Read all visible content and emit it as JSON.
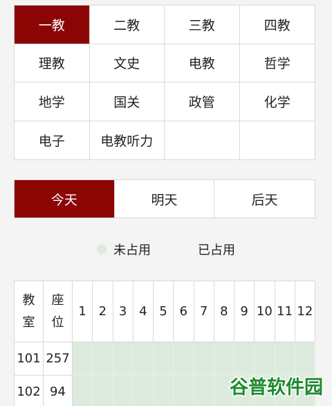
{
  "buildings": [
    "一教",
    "二教",
    "三教",
    "四教",
    "理教",
    "文史",
    "电教",
    "哲学",
    "地学",
    "国关",
    "政管",
    "化学",
    "电子",
    "电教听力",
    "",
    ""
  ],
  "selected_building_index": 0,
  "days": [
    "今天",
    "明天",
    "后天"
  ],
  "selected_day_index": 0,
  "legend": {
    "free": "未占用",
    "used": "已占用"
  },
  "table": {
    "header_room": [
      "教",
      "室"
    ],
    "header_seats": [
      "座",
      "位"
    ],
    "periods": [
      "1",
      "2",
      "3",
      "4",
      "5",
      "6",
      "7",
      "8",
      "9",
      "10",
      "11",
      "12"
    ],
    "rows": [
      {
        "room": "101",
        "seats": "257",
        "status": [
          "free",
          "free",
          "free",
          "free",
          "free",
          "free",
          "free",
          "free",
          "free",
          "free",
          "free",
          "free"
        ]
      },
      {
        "room": "102",
        "seats": "94",
        "status": [
          "free",
          "free",
          "free",
          "free",
          "free",
          "free",
          "free",
          "free",
          "free",
          "free",
          "free",
          "free"
        ]
      }
    ]
  },
  "watermark": "谷普软件园",
  "colors": {
    "accent": "#8b0505",
    "free": "#dcebdd",
    "used": "#f4f4f4",
    "border": "#d8d8d8"
  }
}
